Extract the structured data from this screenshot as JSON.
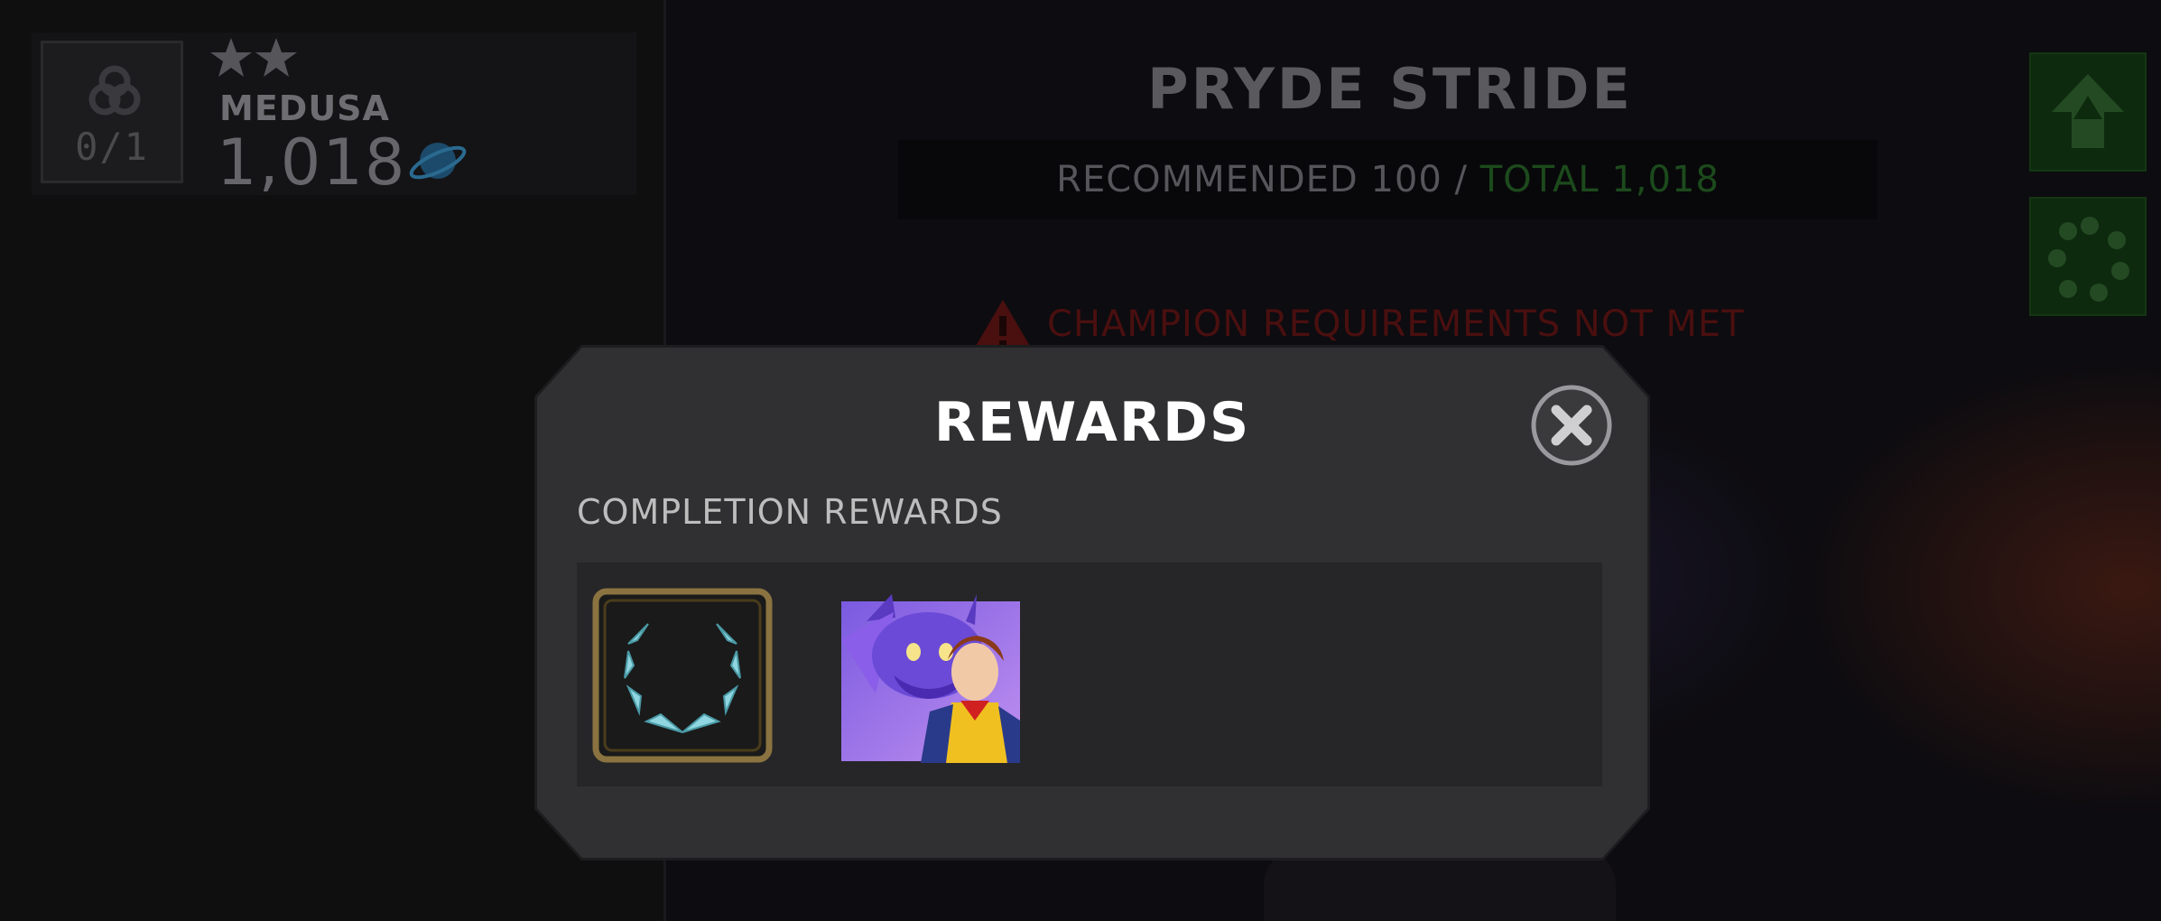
{
  "champion": {
    "name": "MEDUSA",
    "rating": "1,018",
    "slot_count": "0/1",
    "stars": 2,
    "class_icon": "cosmic-swirl-icon",
    "planet_icon": "planet-icon"
  },
  "quest": {
    "title": "PRYDE STRIDE",
    "recommended_label": "RECOMMENDED 100",
    "separator": "/",
    "total_label": "TOTAL 1,018",
    "warning": "CHAMPION REQUIREMENTS NOT MET"
  },
  "side_buttons": [
    {
      "icon": "rank-up-icon"
    },
    {
      "icon": "cycle-icon"
    }
  ],
  "modal": {
    "title": "REWARDS",
    "section_label": "COMPLETION REWARDS",
    "close_icon": "close-icon",
    "rewards": [
      {
        "icon": "laurel-wreath-icon"
      },
      {
        "icon": "dragon-portrait-icon"
      }
    ]
  },
  "colors": {
    "total_green": "#1c4a1c",
    "warning_red": "#4a0f0f",
    "modal_bg": "#303032",
    "laurel": "#8fd6e0",
    "frame_gold": "#8a7340"
  }
}
